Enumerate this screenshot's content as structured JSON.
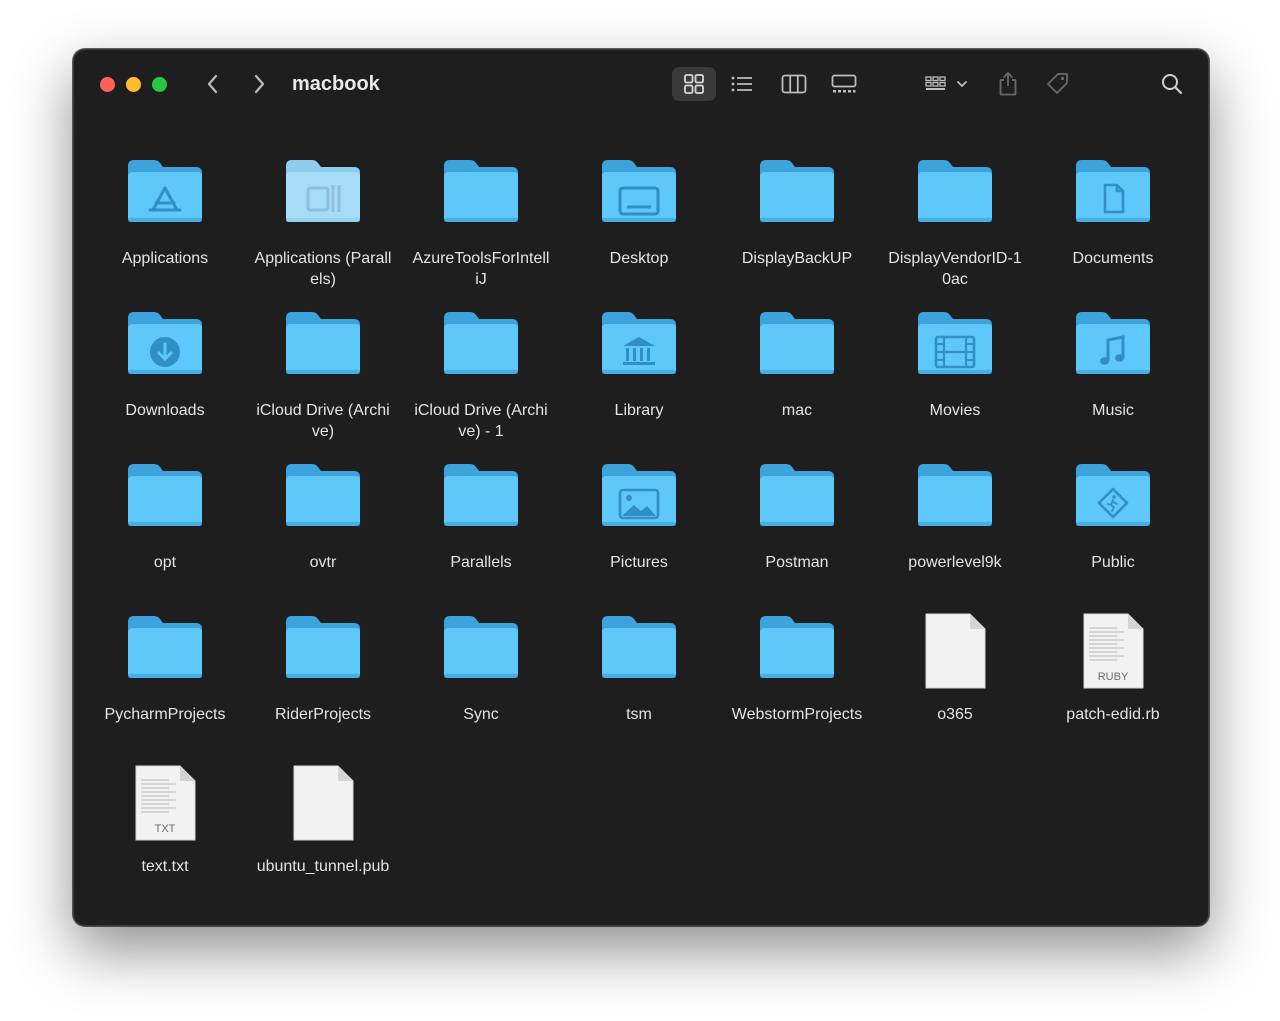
{
  "window": {
    "title": "macbook"
  },
  "colors": {
    "folder_back": "#3da3dc",
    "folder_front": "#5ec8fa",
    "folder_glyph": "#2f8fc6",
    "file_page": "#f2f2f2"
  },
  "items": [
    {
      "label": "Applications",
      "kind": "folder",
      "glyph": "app-store-icon"
    },
    {
      "label": "Applications (Parallels)",
      "kind": "folder-light",
      "glyph": "parallels-icon"
    },
    {
      "label": "AzureToolsForIntelliJ",
      "kind": "folder",
      "glyph": ""
    },
    {
      "label": "Desktop",
      "kind": "folder",
      "glyph": "desktop-icon"
    },
    {
      "label": "DisplayBackUP",
      "kind": "folder",
      "glyph": ""
    },
    {
      "label": "DisplayVendorID-10ac",
      "kind": "folder",
      "glyph": ""
    },
    {
      "label": "Documents",
      "kind": "folder",
      "glyph": "document-icon"
    },
    {
      "label": "Downloads",
      "kind": "folder",
      "glyph": "download-icon"
    },
    {
      "label": "iCloud Drive (Archive)",
      "kind": "folder",
      "glyph": ""
    },
    {
      "label": "iCloud Drive (Archive) - 1",
      "kind": "folder",
      "glyph": ""
    },
    {
      "label": "Library",
      "kind": "folder",
      "glyph": "library-icon"
    },
    {
      "label": "mac",
      "kind": "folder",
      "glyph": ""
    },
    {
      "label": "Movies",
      "kind": "folder",
      "glyph": "film-icon"
    },
    {
      "label": "Music",
      "kind": "folder",
      "glyph": "music-note-icon"
    },
    {
      "label": "opt",
      "kind": "folder",
      "glyph": ""
    },
    {
      "label": "ovtr",
      "kind": "folder",
      "glyph": ""
    },
    {
      "label": "Parallels",
      "kind": "folder",
      "glyph": ""
    },
    {
      "label": "Pictures",
      "kind": "folder",
      "glyph": "picture-icon"
    },
    {
      "label": "Postman",
      "kind": "folder",
      "glyph": ""
    },
    {
      "label": "powerlevel9k",
      "kind": "folder",
      "glyph": ""
    },
    {
      "label": "Public",
      "kind": "folder",
      "glyph": "public-sign-icon"
    },
    {
      "label": "PycharmProjects",
      "kind": "folder",
      "glyph": ""
    },
    {
      "label": "RiderProjects",
      "kind": "folder",
      "glyph": ""
    },
    {
      "label": "Sync",
      "kind": "folder",
      "glyph": ""
    },
    {
      "label": "tsm",
      "kind": "folder",
      "glyph": ""
    },
    {
      "label": "WebstormProjects",
      "kind": "folder",
      "glyph": ""
    },
    {
      "label": "o365",
      "kind": "file",
      "badge": ""
    },
    {
      "label": "patch-edid.rb",
      "kind": "file-doc",
      "badge": "RUBY"
    },
    {
      "label": "text.txt",
      "kind": "file-doc",
      "badge": "TXT"
    },
    {
      "label": "ubuntu_tunnel.pub",
      "kind": "file",
      "badge": ""
    }
  ],
  "toolbar_icons": [
    "chevron-left-icon",
    "chevron-right-icon",
    "icon-view-icon",
    "list-view-icon",
    "column-view-icon",
    "gallery-view-icon",
    "group-by-icon",
    "share-icon",
    "tag-icon",
    "search-icon"
  ]
}
